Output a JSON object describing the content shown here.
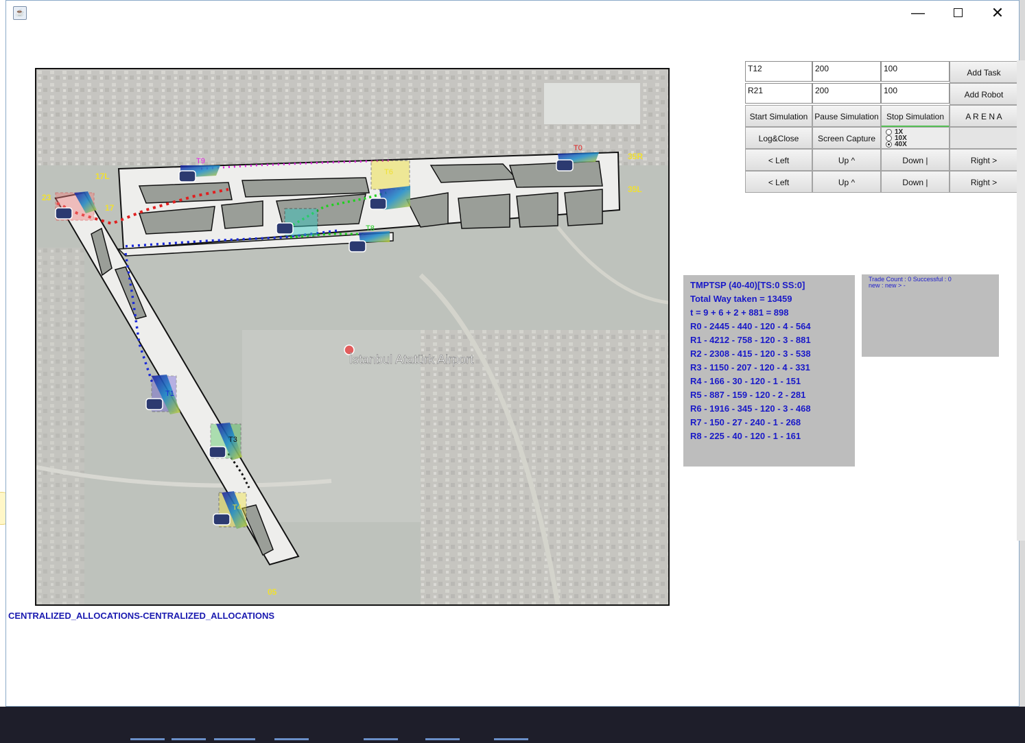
{
  "window": {
    "title_icon": "java-cup-icon",
    "controls": {
      "minimize": "—",
      "maximize": "☐",
      "close": "✕"
    }
  },
  "map": {
    "airport_label": "İstanbul Atatürk Airport",
    "runway_labels": [
      "17L",
      "17",
      "23",
      "35R",
      "35L",
      "05"
    ],
    "task_labels": [
      "T9",
      "T0",
      "T6",
      "T8",
      "T1",
      "T3",
      "T4"
    ],
    "colors": {
      "red": "#e02020",
      "magenta": "#e020e0",
      "blue": "#1a2ad8",
      "green": "#20d020",
      "black": "#111111",
      "label_yellow": "#f0e030"
    }
  },
  "status_label": "CENTRALIZED_ALLOCATIONS-CENTRALIZED_ALLOCATIONS",
  "controls": {
    "task_name": "T12",
    "task_val1": "200",
    "task_val2": "100",
    "add_task": "Add Task",
    "robot_name": "R21",
    "robot_val1": "200",
    "robot_val2": "100",
    "add_robot": "Add Robot",
    "start_sim": "Start Simulation",
    "pause_sim": "Pause Simulation",
    "stop_sim": "Stop Simulation",
    "arena": "A R E N A",
    "log_close": "Log&Close",
    "screen_capture": "Screen Capture",
    "speed_options": [
      "1X",
      "10X",
      "40X"
    ],
    "speed_selected": "40X",
    "left1": "< Left",
    "up1": "Up ^",
    "down1": "Down |",
    "right1": "Right >",
    "left2": "< Left",
    "up2": "Up ^",
    "down2": "Down |",
    "right2": "Right >"
  },
  "info_panel": {
    "lines": [
      "TMPTSP (40-40)[TS:0 SS:0]",
      "Total Way taken =  13459",
      "t = 9 + 6 + 2 + 881 = 898",
      "R0 - 2445 - 440 - 120 - 4 - 564",
      "R1 - 4212 - 758 - 120 - 3 - 881",
      "R2 - 2308 - 415 - 120 - 3 - 538",
      "R3 - 1150 - 207 - 120 - 4 - 331",
      "R4 - 166 - 30 - 120 - 1 - 151",
      "R5 - 887 - 159 - 120 - 2 - 281",
      "R6 - 1916 - 345 - 120 - 3 - 468",
      "R7 - 150 - 27 - 240 - 1 - 268",
      "R8 - 225 - 40 - 120 - 1 - 161"
    ]
  },
  "trade_panel": {
    "line1": "Trade Count : 0 Successful : 0",
    "line2": "new  :  new  >  -"
  }
}
